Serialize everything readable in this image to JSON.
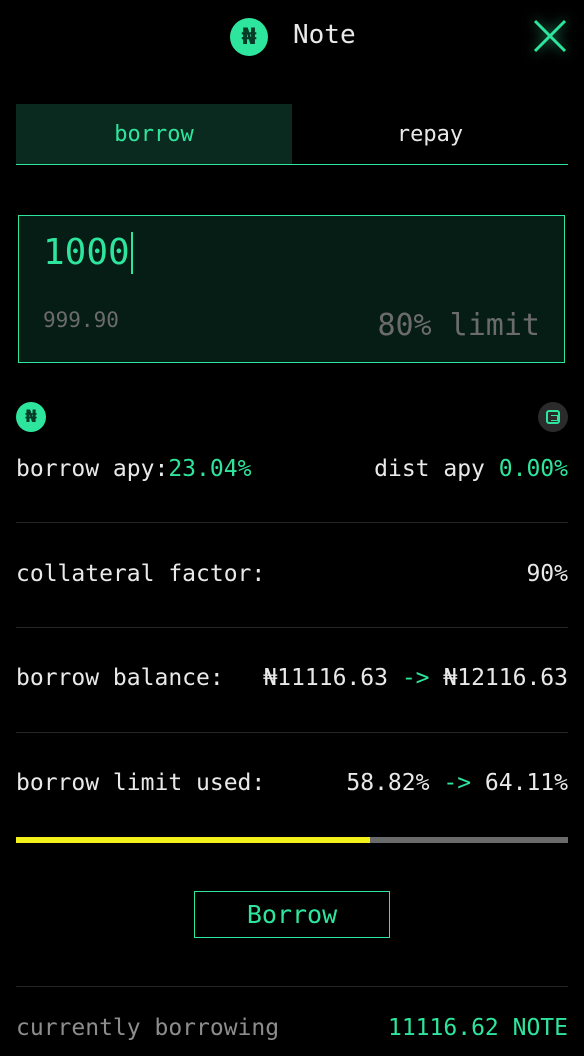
{
  "header": {
    "token_symbol_glyph": "₦",
    "title": "Note",
    "close_icon": "close-icon"
  },
  "tabs": [
    {
      "label": "borrow",
      "active": true
    },
    {
      "label": "repay",
      "active": false
    }
  ],
  "amount": {
    "value": "1000",
    "sub_value": "999.90",
    "limit_label": "80% limit"
  },
  "icons": {
    "left": "note-token-icon",
    "right": "canto-token-icon"
  },
  "stats": {
    "borrow_apy_label": "borrow apy:",
    "borrow_apy_value": "23.04%",
    "dist_apy_label": "dist apy ",
    "dist_apy_value": "0.00%",
    "collateral_label": "collateral factor:",
    "collateral_value": "90%",
    "balance_label": "borrow balance:",
    "balance_from": "₦11116.63",
    "balance_arrow": "->",
    "balance_to": "₦12116.63",
    "limit_used_label": "borrow limit used:",
    "limit_used_from": "58.82%",
    "limit_used_arrow": "->",
    "limit_used_to": "64.11%"
  },
  "progress": {
    "fraction": 0.6411,
    "fill_color": "#f2f21a",
    "track_color": "#6a6a6a"
  },
  "action": {
    "label": "Borrow"
  },
  "footer": {
    "label": "currently borrowing",
    "value": "11116.62 NOTE"
  },
  "colors": {
    "accent": "#2ee59d",
    "background": "#000000"
  }
}
